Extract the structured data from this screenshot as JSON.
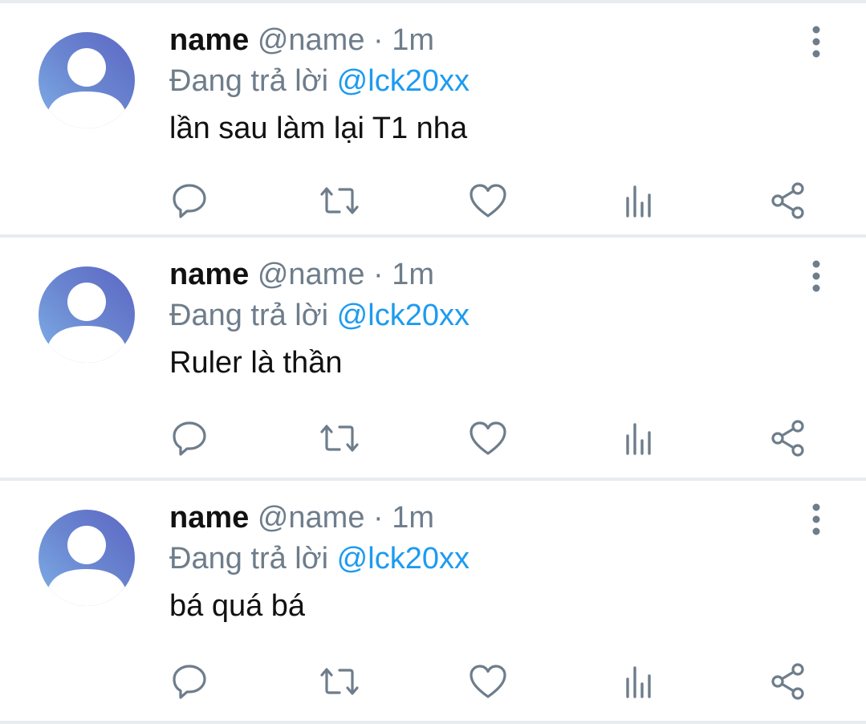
{
  "colors": {
    "name": "#111111",
    "meta": "#6e7d8b",
    "mention": "#1d9bf0",
    "divider": "#e9ecef",
    "icon": "#6e7d8b"
  },
  "icons": {
    "reply": "comment-bubble-icon",
    "retweet": "retweet-icon",
    "like": "heart-icon",
    "views": "bar-chart-icon",
    "share": "share-icon",
    "more": "vertical-ellipsis-icon",
    "avatar": "default-user-avatar-icon"
  },
  "tweets": [
    {
      "name": "name",
      "handle": "@name",
      "separator": "·",
      "time": "1m",
      "reply_prefix": "Đang trả lời",
      "reply_to": "@lck20xx",
      "text": "lần sau làm lại T1 nha"
    },
    {
      "name": "name",
      "handle": "@name",
      "separator": "·",
      "time": "1m",
      "reply_prefix": "Đang trả lời",
      "reply_to": "@lck20xx",
      "text": "Ruler là thần"
    },
    {
      "name": "name",
      "handle": "@name",
      "separator": "·",
      "time": "1m",
      "reply_prefix": "Đang trả lời",
      "reply_to": "@lck20xx",
      "text": "bá quá bá"
    }
  ]
}
